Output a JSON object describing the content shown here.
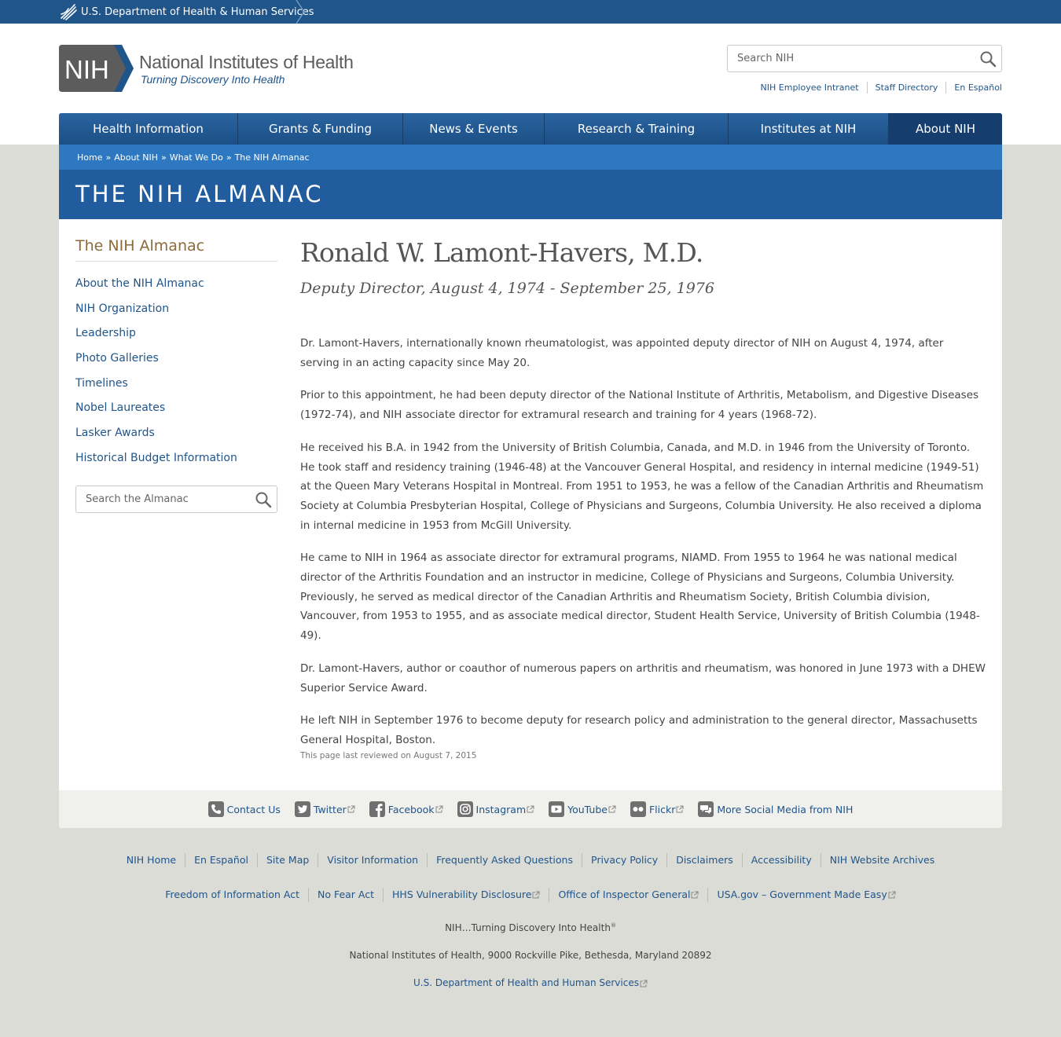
{
  "hhs": {
    "label": "U.S. Department of Health & Human Services"
  },
  "logo": {
    "mark": "NIH",
    "name": "National Institutes of Health",
    "tagline": "Turning Discovery Into Health"
  },
  "search": {
    "placeholder": "Search NIH"
  },
  "util_links": [
    "NIH Employee Intranet",
    "Staff Directory",
    "En Español"
  ],
  "nav": {
    "items": [
      "Health Information",
      "Grants & Funding",
      "News & Events",
      "Research & Training",
      "Institutes at NIH",
      "About NIH"
    ],
    "active": "About NIH"
  },
  "breadcrumb": [
    "Home",
    "About NIH",
    "What We Do",
    "The NIH Almanac"
  ],
  "breadcrumb_separator": "»",
  "section_title": "THE NIH ALMANAC",
  "sidenav": {
    "title": "The NIH Almanac",
    "items": [
      "About the NIH Almanac",
      "NIH Organization",
      "Leadership",
      "Photo Galleries",
      "Timelines",
      "Nobel Laureates",
      "Lasker Awards",
      "Historical Budget Information"
    ],
    "search_placeholder": "Search the Almanac"
  },
  "article": {
    "title": "Ronald W. Lamont-Havers, M.D.",
    "subtitle": "Deputy Director, August 4, 1974 - September 25, 1976",
    "paragraphs": [
      "Dr. Lamont-Havers, internationally known rheumatologist, was appointed deputy director of NIH on August 4, 1974, after serving in an acting capacity since May 20.",
      "Prior to this appointment, he had been deputy director of the National Institute of Arthritis, Metabolism, and Digestive Diseases (1972-74), and NIH associate director for extramural research and training for 4 years (1968-72).",
      "He received his B.A. in 1942 from the University of British Columbia, Canada, and M.D. in 1946 from the University of Toronto. He took staff and residency training (1946-48) at the Vancouver General Hospital, and residency in internal medicine (1949-51) at the Queen Mary Veterans Hospital in Montreal. From 1951 to 1953, he was a fellow of the Canadian Arthritis and Rheumatism Society at Columbia Presbyterian Hospital, College of Physicians and Surgeons, Columbia University. He also received a diploma in internal medicine in 1953 from McGill University.",
      "He came to NIH in 1964 as associate director for extramural programs, NIAMD. From 1955 to 1964 he was national medical director of the Arthritis Foundation and an instructor in medicine, College of Physicians and Surgeons, Columbia University. Previously, he served as medical director of the Canadian Arthritis and Rheumatism Society, British Columbia division, Vancouver, from 1953 to 1955, and as associate medical director, Student Health Service, University of British Columbia (1948-49).",
      "Dr. Lamont-Havers, author or coauthor of numerous papers on arthritis and rheumatism, was honored in June 1973 with a DHEW Superior Service Award.",
      "He left NIH in September 1976 to become deputy for research policy and administration to the general director, Massachusetts General Hospital, Boston."
    ],
    "reviewed": "This page last reviewed on August 7, 2015"
  },
  "social": [
    {
      "label": "Contact Us",
      "icon": "phone-icon",
      "external": false
    },
    {
      "label": "Twitter",
      "icon": "twitter-icon",
      "external": true
    },
    {
      "label": "Facebook",
      "icon": "facebook-icon",
      "external": true
    },
    {
      "label": "Instagram",
      "icon": "instagram-icon",
      "external": true
    },
    {
      "label": "YouTube",
      "icon": "youtube-icon",
      "external": true
    },
    {
      "label": "Flickr",
      "icon": "flickr-icon",
      "external": true
    },
    {
      "label": "More Social Media from NIH",
      "icon": "chat-bubbles-icon",
      "external": false
    }
  ],
  "footer": {
    "row1": [
      "NIH Home",
      "En Español",
      "Site Map",
      "Visitor Information",
      "Frequently Asked Questions",
      "Privacy Policy",
      "Disclaimers",
      "Accessibility",
      "NIH Website Archives"
    ],
    "row2": [
      {
        "label": "Freedom of Information Act",
        "external": false
      },
      {
        "label": "No Fear Act",
        "external": false
      },
      {
        "label": "HHS Vulnerability Disclosure",
        "external": true
      },
      {
        "label": "Office of Inspector General",
        "external": true
      },
      {
        "label": "USA.gov – Government Made Easy",
        "external": true
      }
    ],
    "tagline": "NIH…Turning Discovery Into Health",
    "tagline_mark": "®",
    "address": "National Institutes of Health, 9000 Rockville Pike, Bethesda, Maryland 20892",
    "hhs_link": "U.S. Department of Health and Human Services"
  },
  "colors": {
    "primary": "#20558a",
    "accent": "#8b6b3a",
    "breadcrumb_bar": "#2d78c0",
    "banner": "#205c9e"
  }
}
